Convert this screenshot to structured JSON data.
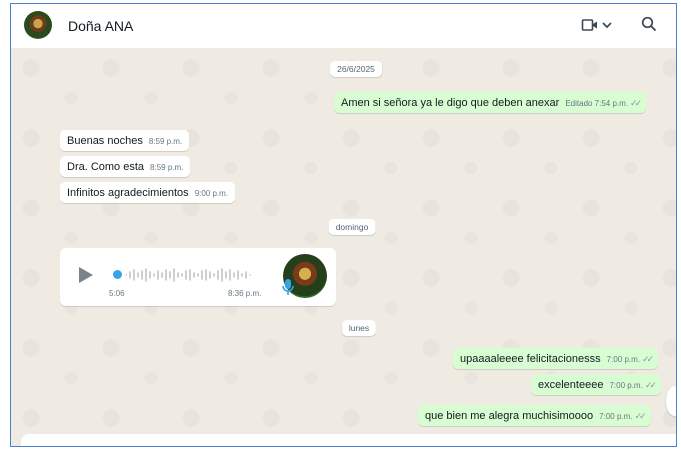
{
  "header": {
    "contact_name": "Doña ANA"
  },
  "date_labels": {
    "first": "26/6/2025",
    "second": "domingo",
    "third": "lunes"
  },
  "messages": [
    {
      "text": "Amen si señora ya le digo que deben anexar",
      "meta": "Editado 7:54 p.m.",
      "direction": "outgoing"
    },
    {
      "text": "Buenas noches",
      "meta": "8:59 p.m.",
      "direction": "incoming"
    },
    {
      "text": "Dra. Como esta",
      "meta": "8:59 p.m.",
      "direction": "incoming"
    },
    {
      "text": "Infinitos agradecimientos",
      "meta": "9:00 p.m.",
      "direction": "incoming"
    },
    {
      "text": "upaaaaleeee felicitacionesss",
      "meta": "7:00 p.m.",
      "direction": "outgoing"
    },
    {
      "text": "excelenteeee",
      "meta": "7:00 p.m.",
      "direction": "outgoing"
    },
    {
      "text": "que bien me alegra muchisimoooo",
      "meta": "7:00 p.m.",
      "direction": "outgoing"
    }
  ],
  "voice_note": {
    "duration": "5:06",
    "time": "8:36 p.m."
  },
  "icons": [
    "video-call-icon",
    "chevron-down-icon",
    "search-icon",
    "play-icon",
    "microphone-icon",
    "read-receipt-icon"
  ],
  "colors": {
    "chat_background": "#efeae2",
    "outgoing_bubble": "#d9fdd3",
    "incoming_bubble": "#ffffff",
    "voice_accent": "#34a4e7"
  }
}
